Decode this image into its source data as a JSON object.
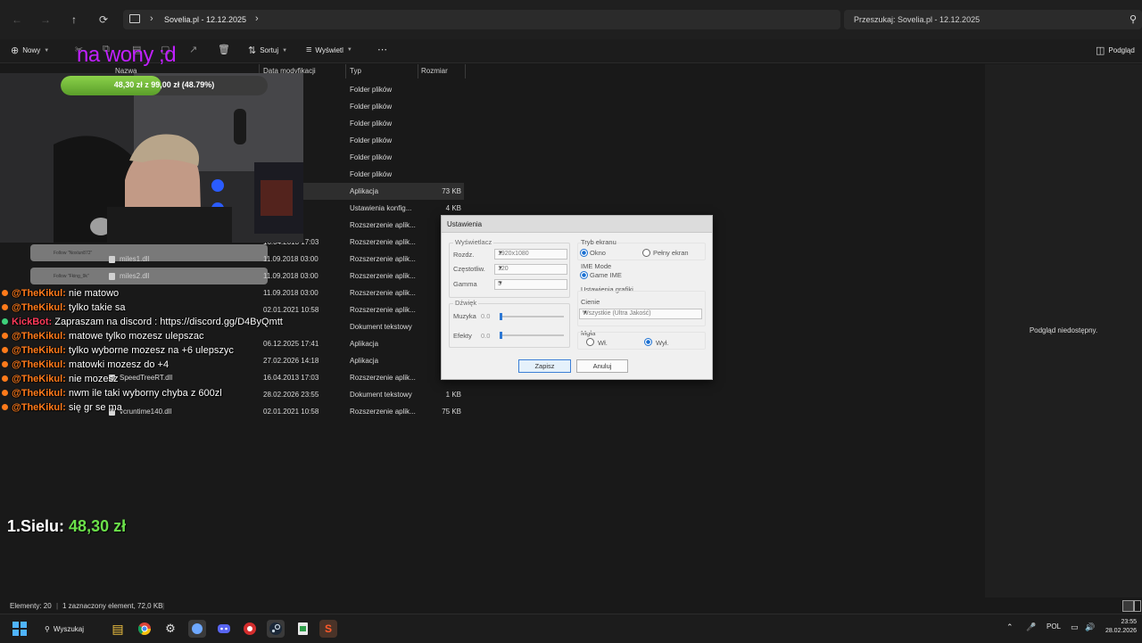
{
  "explorer": {
    "path": "Sovelia.pl - 12.12.2025",
    "search_placeholder": "Przeszukaj: Sovelia.pl - 12.12.2025",
    "toolbar": {
      "new": "Nowy",
      "sort": "Sortuj",
      "view": "Wyświetl",
      "preview": "Podgląd"
    },
    "columns": {
      "name": "Nazwa",
      "modified": "Data modyfikacji",
      "type": "Typ",
      "size": "Rozmiar"
    },
    "files": [
      {
        "name": "",
        "date": ":48",
        "type": "Folder plików",
        "size": ""
      },
      {
        "name": "",
        "date": ":48",
        "type": "Folder plików",
        "size": ""
      },
      {
        "name": "",
        "date": ":48",
        "type": "Folder plików",
        "size": ""
      },
      {
        "name": "",
        "date": ":58",
        "type": "Folder plików",
        "size": ""
      },
      {
        "name": "",
        "date": ":52",
        "type": "Folder plików",
        "size": ""
      },
      {
        "name": "",
        "date": ":48",
        "type": "Folder plików",
        "size": ""
      },
      {
        "name": "",
        "date": ":13",
        "type": "Aplikacja",
        "size": "73 KB"
      },
      {
        "name": "",
        "date": ":36",
        "type": "Ustawienia konfig...",
        "size": "4 KB"
      },
      {
        "name": "",
        "date": ":03",
        "type": "Rozszerzenie aplik...",
        "size": ""
      },
      {
        "name": "",
        "date": "16.04.2013 17:03",
        "type": "Rozszerzenie aplik...",
        "size": ""
      },
      {
        "name": "miles1.dll",
        "date": "11.09.2018 03:00",
        "type": "Rozszerzenie aplik...",
        "size": ""
      },
      {
        "name": "miles2.dll",
        "date": "11.09.2018 03:00",
        "type": "Rozszerzenie aplik...",
        "size": ""
      },
      {
        "name": "",
        "date": "11.09.2018 03:00",
        "type": "Rozszerzenie aplik...",
        "size": ""
      },
      {
        "name": "",
        "date": "02.01.2021 10:58",
        "type": "Rozszerzenie aplik...",
        "size": ""
      },
      {
        "name": "",
        "date": "",
        "type": "Dokument tekstowy",
        "size": ""
      },
      {
        "name": "",
        "date": "06.12.2025 17:41",
        "type": "Aplikacja",
        "size": ""
      },
      {
        "name": "",
        "date": "27.02.2026 14:18",
        "type": "Aplikacja",
        "size": "28"
      },
      {
        "name": "SpeedTreeRT.dll",
        "date": "16.04.2013 17:03",
        "type": "Rozszerzenie aplik...",
        "size": "1"
      },
      {
        "name": "",
        "date": "28.02.2026 23:55",
        "type": "Dokument tekstowy",
        "size": "1 KB"
      },
      {
        "name": "vcruntime140.dll",
        "date": "02.01.2021 10:58",
        "type": "Rozszerzenie aplik...",
        "size": "75 KB"
      }
    ],
    "preview_empty": "Podgląd niedostępny.",
    "status": {
      "count": "Elementy: 20",
      "selected": "1 zaznaczony element, 72,0 KB"
    }
  },
  "dialog": {
    "title": "Ustawienia",
    "display_group": "Wyświetlacz",
    "resolution_label": "Rozdz.",
    "resolution_value": "1920x1080",
    "frequency_label": "Częstotliw.",
    "frequency_value": "120",
    "gamma_label": "Gamma",
    "gamma_value": "5",
    "sound_group": "Dźwięk",
    "music_label": "Muzyka",
    "music_value": "0.0",
    "effects_label": "Efekty",
    "effects_value": "0.0",
    "screen_mode_group": "Tryb ekranu",
    "window_option": "Okno",
    "fullscreen_option": "Pełny ekran",
    "ime_group": "IME Mode",
    "ime_option": "Game IME",
    "graphics_group": "Ustawienia grafiki",
    "shadows_label": "Cienie",
    "shadows_value": "Wszystkie (Ultra Jakość)",
    "fog_label": "Mgła",
    "fog_on": "Wł.",
    "fog_off": "Wył.",
    "save_button": "Zapisz",
    "cancel_button": "Anuluj"
  },
  "overlay": {
    "title": "na wony ;d",
    "goal_text": "48,30 zł z 99,00 zł (48.79%)",
    "goal_fraction": 0.4879,
    "alerts": [
      "Follow \"Noxlun872\"",
      "Follow \"Fking_9k\""
    ],
    "chat": [
      {
        "user": "@TheKikul:",
        "text": " nie matowo"
      },
      {
        "user": "@TheKikul:",
        "text": " tylko takie sa"
      },
      {
        "user": "KickBot:",
        "text": " Zapraszam na discord : https://discord.gg/D4ByQmtt",
        "bot": true
      },
      {
        "user": "@TheKikul:",
        "text": " matowe tylko mozesz ulepszac"
      },
      {
        "user": "@TheKikul:",
        "text": " tylko wyborne mozesz na +6 ulepszyc"
      },
      {
        "user": "@TheKikul:",
        "text": " matowki mozesz do +4"
      },
      {
        "user": "@TheKikul:",
        "text": " nie mozesz"
      },
      {
        "user": "@TheKikul:",
        "text": " nwm ile taki wyborny chyba z 600zl"
      },
      {
        "user": "@TheKikul:",
        "text": " się gr se ma"
      }
    ],
    "leader_rank": "1.Sielu:",
    "leader_amount": "48,30 zł"
  },
  "taskbar": {
    "search": "Wyszukaj",
    "language": "POL",
    "time": "23:55",
    "date": "28.02.2026"
  }
}
